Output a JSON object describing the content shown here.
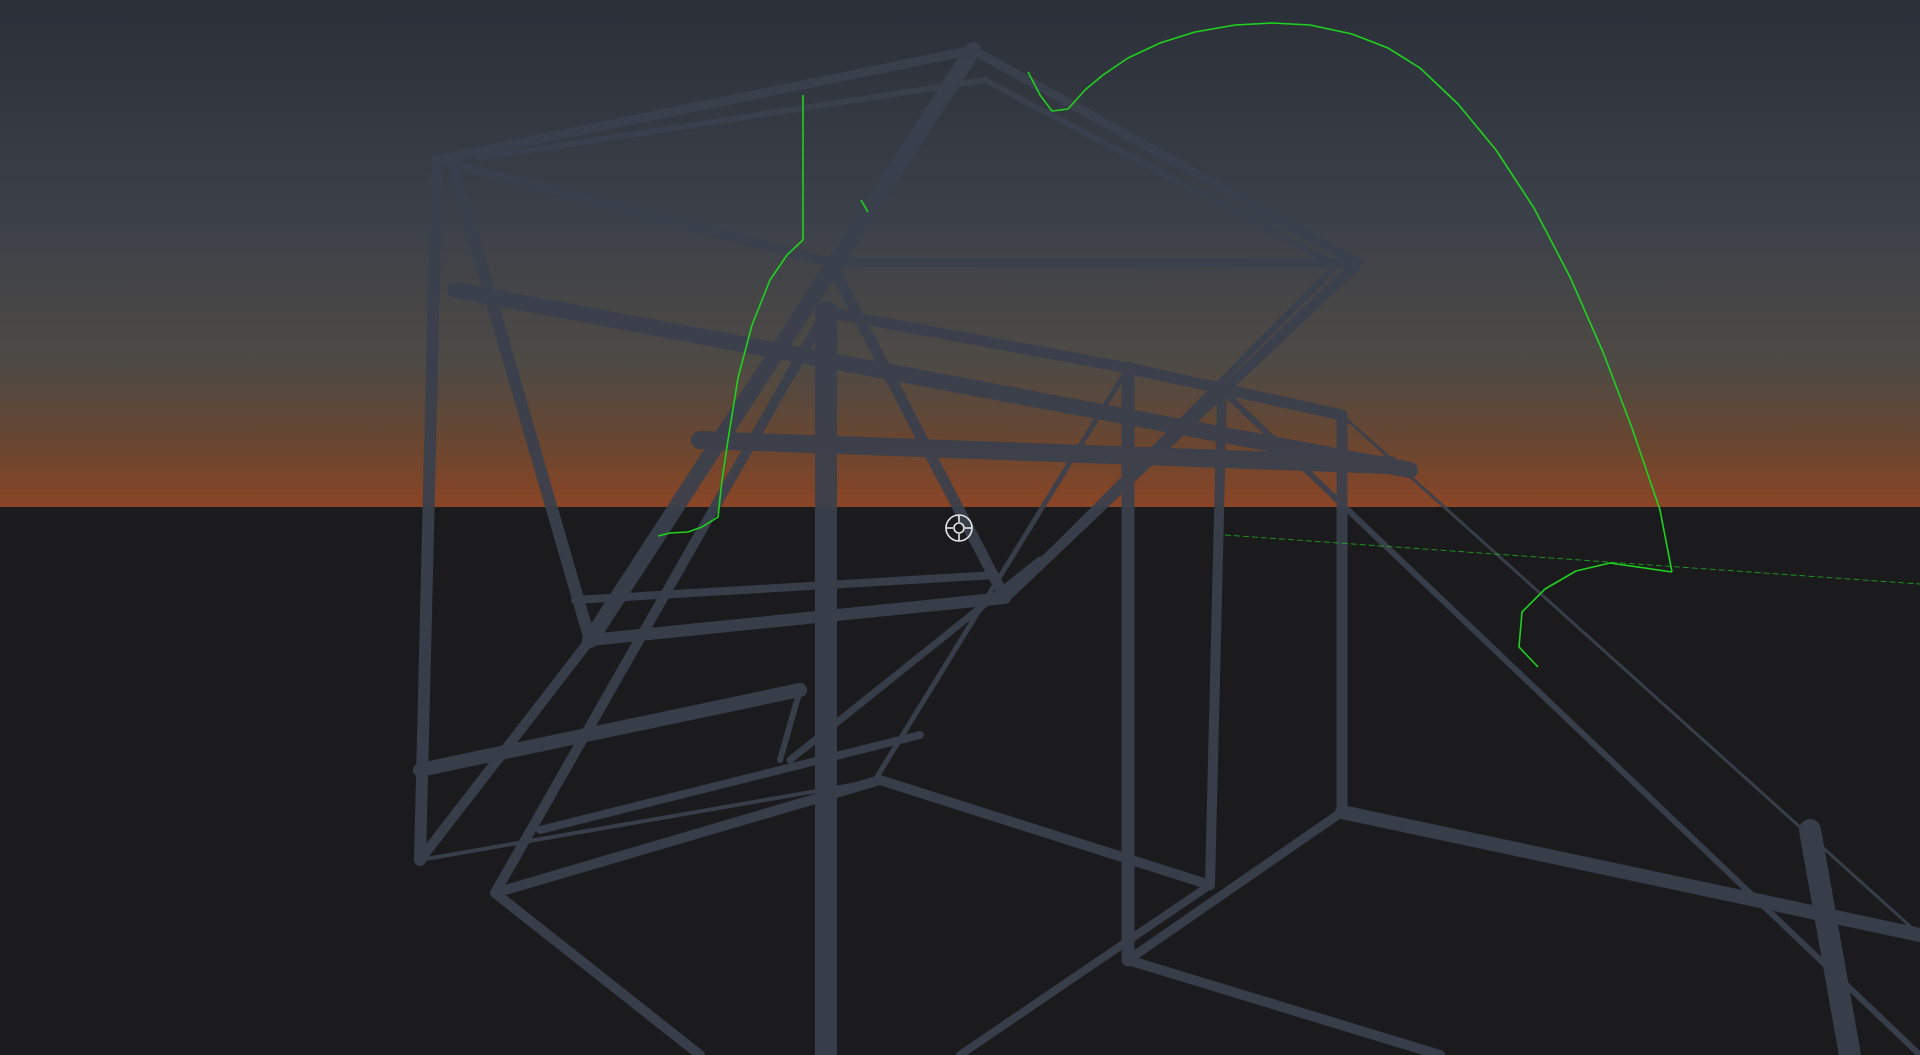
{
  "scene": {
    "sky_top_color": "#2c313b",
    "sky_mid_color": "#3e424a",
    "horizon_glow_color": "#6f4a2f",
    "horizon_edge_color": "#8a4a28",
    "ground_color": "#1b1b1d",
    "frame_color": "#3a404d",
    "trajectory_color": "#1fd11f",
    "crosshair_color": "#e6e6e6"
  },
  "icons": {
    "crosshair": "crosshair-reticle-icon"
  }
}
